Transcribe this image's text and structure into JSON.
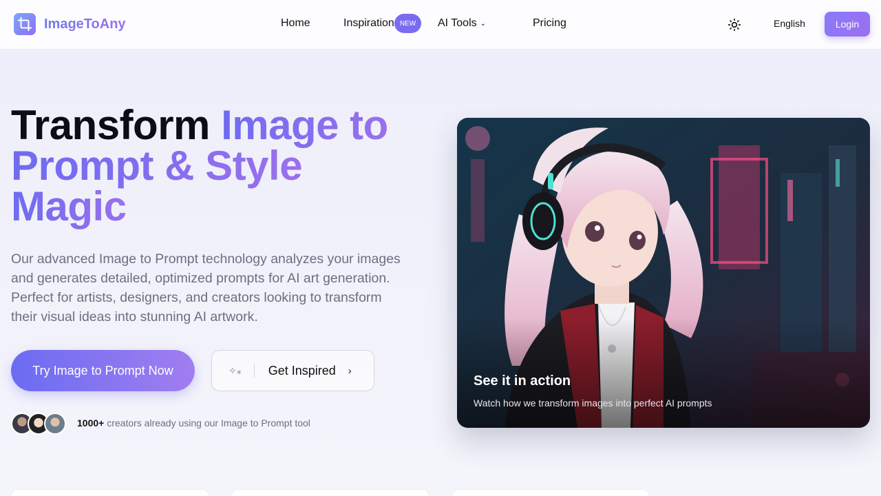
{
  "brand": {
    "name": "ImageToAny",
    "logo_icon": "crop-icon"
  },
  "nav": {
    "home": "Home",
    "inspiration": "Inspiration",
    "badge": "NEW",
    "ai_tools": "AI Tools",
    "pricing": "Pricing",
    "theme_icon": "sun-icon",
    "language": "English",
    "login": "Login"
  },
  "hero": {
    "title_dark": "Transform ",
    "title_accent_1": "Image to",
    "title_accent_2": "Prompt & Style",
    "title_accent_3": "Magic",
    "description": "Our advanced Image to Prompt technology analyzes your images and generates detailed, optimized prompts for AI art generation. Perfect for artists, designers, and creators looking to transform their visual ideas into stunning AI artwork.",
    "primary_cta": "Try Image to Prompt Now",
    "secondary_cta": "Get Inspired",
    "social_count": "1000+",
    "social_text": " creators already using our Image to Prompt tool"
  },
  "media": {
    "title": "See it in action",
    "subtitle": "Watch how we transform images into perfect AI prompts"
  },
  "colors": {
    "accent": "#7b6bf0",
    "accent_2": "#9b6ff0"
  }
}
